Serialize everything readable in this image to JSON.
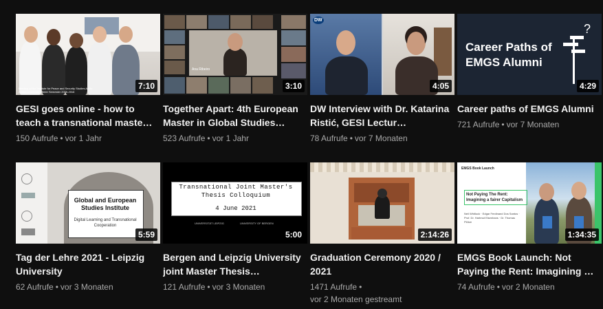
{
  "videos": [
    {
      "title": "GESI goes online - how to teach a transnational maste…",
      "duration": "7:10",
      "views": "150 Aufrufe",
      "age": "vor 1 Jahr",
      "thumb_caption": "Meeting at the Institute for Peace and Security Studies Addis Ababa University Winter Semester 2015-2016"
    },
    {
      "title": "Together Apart: 4th European Master in Global Studies…",
      "duration": "3:10",
      "views": "523 Aufrufe",
      "age": "vor 1 Jahr",
      "thumb_caption": "Ana Ribeiro"
    },
    {
      "title": "DW Interview with Dr. Katarina Ristić, GESI Lectur…",
      "duration": "4:05",
      "views": "78 Aufrufe",
      "age": "vor 7 Monaten",
      "thumb_caption": "DW"
    },
    {
      "title": "Career paths of EMGS Alumni",
      "duration": "4:29",
      "views": "721 Aufrufe",
      "age": "vor 7 Monaten",
      "thumb_caption": "Career Paths of EMGS Alumni"
    },
    {
      "title": "Tag der Lehre 2021 - Leipzig University",
      "duration": "5:59",
      "views": "62 Aufrufe",
      "age": "vor 3 Monaten",
      "thumb_caption": "Global and European Studies Institute",
      "thumb_sub": "Digital Learning and Transnational Cooperation"
    },
    {
      "title": "Bergen and Leipzig University joint Master Thesis…",
      "duration": "5:00",
      "views": "121 Aufrufe",
      "age": "vor 3 Monaten",
      "thumb_caption": "Transnational Joint Master's Thesis Colloquium",
      "thumb_date": "4 June 2021",
      "thumb_logo_left": "UNIVERSITÄT LEIPZIG",
      "thumb_logo_right": "UNIVERSITY OF BERGEN"
    },
    {
      "title": "Graduation Ceremony 2020 / 2021",
      "duration": "2:14:26",
      "views": "1471 Aufrufe",
      "age": "vor 2 Monaten gestreamt"
    },
    {
      "title": "EMGS Book Launch: Not Paying the Rent: Imagining …",
      "duration": "1:34:35",
      "views": "74 Aufrufe",
      "age": "vor 2 Monaten",
      "thumb_caption": "EMGS Book Launch",
      "thumb_book": "Not Paying The Rent: Imagining a fairer Capitalism",
      "thumb_authors": "Neil Whitlock · Edgar Ferdinand Dos Santos · Prof. Dr. Hartmut Elsenhans · Dr. Thomas Plötze"
    }
  ]
}
